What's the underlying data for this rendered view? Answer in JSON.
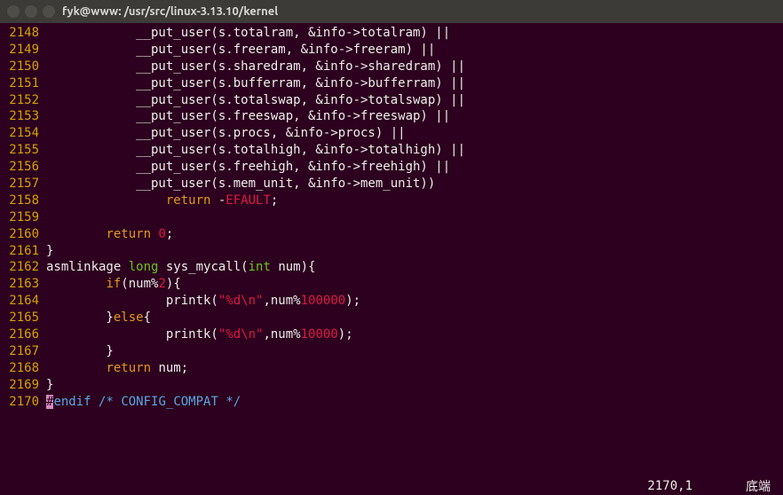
{
  "window": {
    "title": "fyk@www: /usr/src/linux-3.13.10/kernel"
  },
  "lines": [
    {
      "n": "2148",
      "seg": [
        [
          "",
          "            __put_user(s.totalram, &info->totalram) ||"
        ]
      ]
    },
    {
      "n": "2149",
      "seg": [
        [
          "",
          "            __put_user(s.freeram, &info->freeram) ||"
        ]
      ]
    },
    {
      "n": "2150",
      "seg": [
        [
          "",
          "            __put_user(s.sharedram, &info->sharedram) ||"
        ]
      ]
    },
    {
      "n": "2151",
      "seg": [
        [
          "",
          "            __put_user(s.bufferram, &info->bufferram) ||"
        ]
      ]
    },
    {
      "n": "2152",
      "seg": [
        [
          "",
          "            __put_user(s.totalswap, &info->totalswap) ||"
        ]
      ]
    },
    {
      "n": "2153",
      "seg": [
        [
          "",
          "            __put_user(s.freeswap, &info->freeswap) ||"
        ]
      ]
    },
    {
      "n": "2154",
      "seg": [
        [
          "",
          "            __put_user(s.procs, &info->procs) ||"
        ]
      ]
    },
    {
      "n": "2155",
      "seg": [
        [
          "",
          "            __put_user(s.totalhigh, &info->totalhigh) ||"
        ]
      ]
    },
    {
      "n": "2156",
      "seg": [
        [
          "",
          "            __put_user(s.freehigh, &info->freehigh) ||"
        ]
      ]
    },
    {
      "n": "2157",
      "seg": [
        [
          "",
          "            __put_user(s.mem_unit, &info->mem_unit))"
        ]
      ]
    },
    {
      "n": "2158",
      "seg": [
        [
          "",
          "                "
        ],
        [
          "kw",
          "return"
        ],
        [
          "",
          " -"
        ],
        [
          "num",
          "EFAULT"
        ],
        [
          "",
          ";"
        ]
      ]
    },
    {
      "n": "2159",
      "seg": [
        [
          "",
          ""
        ]
      ]
    },
    {
      "n": "2160",
      "seg": [
        [
          "",
          "        "
        ],
        [
          "kw",
          "return"
        ],
        [
          "",
          " "
        ],
        [
          "num",
          "0"
        ],
        [
          "",
          ";"
        ]
      ]
    },
    {
      "n": "2161",
      "seg": [
        [
          "",
          "}"
        ]
      ]
    },
    {
      "n": "2162",
      "seg": [
        [
          "",
          "asmlinkage "
        ],
        [
          "type",
          "long"
        ],
        [
          "",
          " sys_mycall("
        ],
        [
          "type",
          "int"
        ],
        [
          "",
          " num){"
        ]
      ]
    },
    {
      "n": "2163",
      "seg": [
        [
          "",
          "        "
        ],
        [
          "kw",
          "if"
        ],
        [
          "",
          "(num%"
        ],
        [
          "num",
          "2"
        ],
        [
          "",
          "){"
        ]
      ]
    },
    {
      "n": "2164",
      "seg": [
        [
          "",
          "                printk("
        ],
        [
          "str",
          "\"%d\\n\""
        ],
        [
          "",
          ",num%"
        ],
        [
          "num",
          "100000"
        ],
        [
          "",
          ");"
        ]
      ]
    },
    {
      "n": "2165",
      "seg": [
        [
          "",
          "        }"
        ],
        [
          "kw",
          "else"
        ],
        [
          "",
          "{"
        ]
      ]
    },
    {
      "n": "2166",
      "seg": [
        [
          "",
          "                printk("
        ],
        [
          "str",
          "\"%d\\n\""
        ],
        [
          "",
          ",num%"
        ],
        [
          "num",
          "10000"
        ],
        [
          "",
          ");"
        ]
      ]
    },
    {
      "n": "2167",
      "seg": [
        [
          "",
          "        }"
        ]
      ]
    },
    {
      "n": "2168",
      "seg": [
        [
          "",
          "        "
        ],
        [
          "kw",
          "return"
        ],
        [
          "",
          " num;"
        ]
      ]
    },
    {
      "n": "2169",
      "seg": [
        [
          "",
          "}"
        ]
      ]
    },
    {
      "n": "2170",
      "seg": [
        [
          "cursor",
          "#"
        ],
        [
          "preproc",
          "endif"
        ],
        [
          "",
          " "
        ],
        [
          "comment",
          "/* CONFIG_COMPAT */"
        ]
      ]
    }
  ],
  "status": {
    "position": "2170,1",
    "scroll": "底端"
  }
}
